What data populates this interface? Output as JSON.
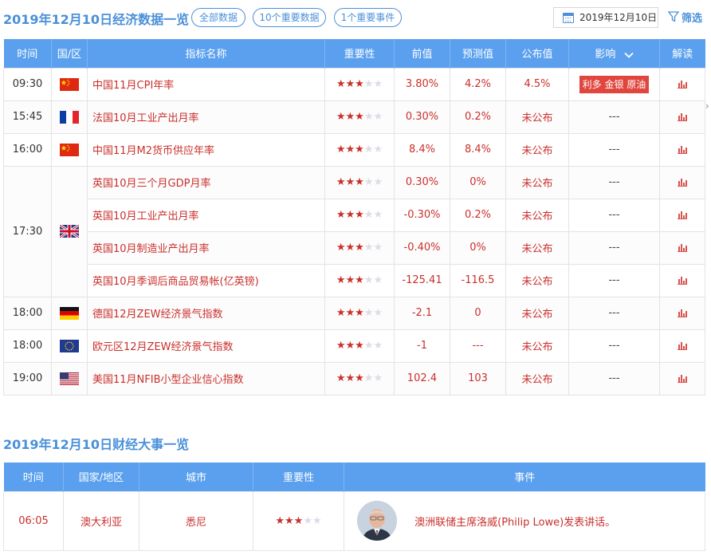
{
  "header": {
    "title": "2019年12月10日经济数据一览",
    "filters": [
      "全部数据",
      "10个重要数据",
      "1个重要事件"
    ],
    "date": "2019年12月10日",
    "filter_label": "筛选"
  },
  "columns": [
    "时间",
    "国/区",
    "指标名称",
    "重要性",
    "前值",
    "预测值",
    "公布值",
    "影响",
    "解读"
  ],
  "rows": [
    {
      "time": "09:30",
      "flag": "cn",
      "name": "中国11月CPI年率",
      "stars": 3,
      "prev": "3.80%",
      "forecast": "4.2%",
      "actual": "4.5%",
      "impact": "利多 金银 原油"
    },
    {
      "time": "15:45",
      "flag": "fr",
      "name": "法国10月工业产出月率",
      "stars": 3,
      "prev": "0.30%",
      "forecast": "0.2%",
      "actual": "未公布",
      "impact": "---"
    },
    {
      "time": "16:00",
      "flag": "cn",
      "name": "中国11月M2货币供应年率",
      "stars": 3,
      "prev": "8.4%",
      "forecast": "8.4%",
      "actual": "未公布",
      "impact": "---"
    },
    {
      "time": "17:30",
      "flag": "uk",
      "name": "英国10月三个月GDP月率",
      "stars": 3,
      "prev": "0.30%",
      "forecast": "0%",
      "actual": "未公布",
      "impact": "---"
    },
    {
      "time": "",
      "flag": "",
      "name": "英国10月工业产出月率",
      "stars": 3,
      "prev": "-0.30%",
      "forecast": "0.2%",
      "actual": "未公布",
      "impact": "---"
    },
    {
      "time": "",
      "flag": "",
      "name": "英国10月制造业产出月率",
      "stars": 3,
      "prev": "-0.40%",
      "forecast": "0%",
      "actual": "未公布",
      "impact": "---"
    },
    {
      "time": "",
      "flag": "",
      "name": "英国10月季调后商品贸易帐(亿英镑)",
      "stars": 3,
      "prev": "-125.41",
      "forecast": "-116.5",
      "actual": "未公布",
      "impact": "---"
    },
    {
      "time": "18:00",
      "flag": "de",
      "name": "德国12月ZEW经济景气指数",
      "stars": 3,
      "prev": "-2.1",
      "forecast": "0",
      "actual": "未公布",
      "impact": "---"
    },
    {
      "time": "18:00",
      "flag": "eu",
      "name": "欧元区12月ZEW经济景气指数",
      "stars": 3,
      "prev": "-1",
      "forecast": "---",
      "actual": "未公布",
      "impact": "---"
    },
    {
      "time": "19:00",
      "flag": "us",
      "name": "美国11月NFIB小型企业信心指数",
      "stars": 3,
      "prev": "102.4",
      "forecast": "103",
      "actual": "未公布",
      "impact": "---"
    }
  ],
  "events": {
    "title": "2019年12月10日财经大事一览",
    "columns": [
      "时间",
      "国家/地区",
      "城市",
      "重要性",
      "事件"
    ],
    "rows": [
      {
        "time": "06:05",
        "country": "澳大利亚",
        "city": "悉尼",
        "stars": 3,
        "event": "澳洲联储主席洛威(Philip Lowe)发表讲话。"
      }
    ]
  },
  "colors": {
    "accent": "#4a90d9",
    "header_bg": "#5aa0ee",
    "red": "#c9302c",
    "impact_bg": "#e0463e"
  }
}
